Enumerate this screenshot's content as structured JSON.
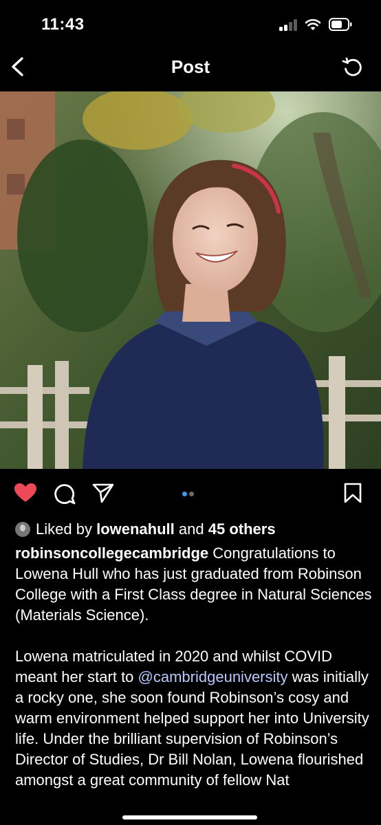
{
  "status_bar": {
    "time": "11:43"
  },
  "nav": {
    "title": "Post"
  },
  "post": {
    "liked_by_prefix": "Liked by",
    "liked_by_user": "lowenahull",
    "liked_by_and": "and",
    "liked_by_others": "45 others",
    "username": "robinsoncollegecambridge",
    "paragraph1": "Congratulations to Lowena Hull who has just graduated from Robinson College with a First Class degree in Natural Sciences (Materials Science).",
    "paragraph2_before": "Lowena matriculated in 2020 and whilst COVID meant her start to ",
    "mention": "@cambridgeuniversity",
    "paragraph2_after": " was initially a rocky one, she soon found Robinson’s cosy and warm environment helped support her into University life.  Under the brilliant supervision of Robinson’s Director of Studies, Dr Bill Nolan, Lowena flourished amongst a great community of fellow Nat",
    "carousel": {
      "count": 2,
      "active": 1
    }
  },
  "icons": [
    "back-icon",
    "refresh-icon",
    "heart-icon",
    "comment-icon",
    "share-icon",
    "bookmark-icon"
  ],
  "colors": {
    "like": "#ed4956",
    "carousel_active": "#3897f0",
    "mention": "#b8c8ff"
  }
}
